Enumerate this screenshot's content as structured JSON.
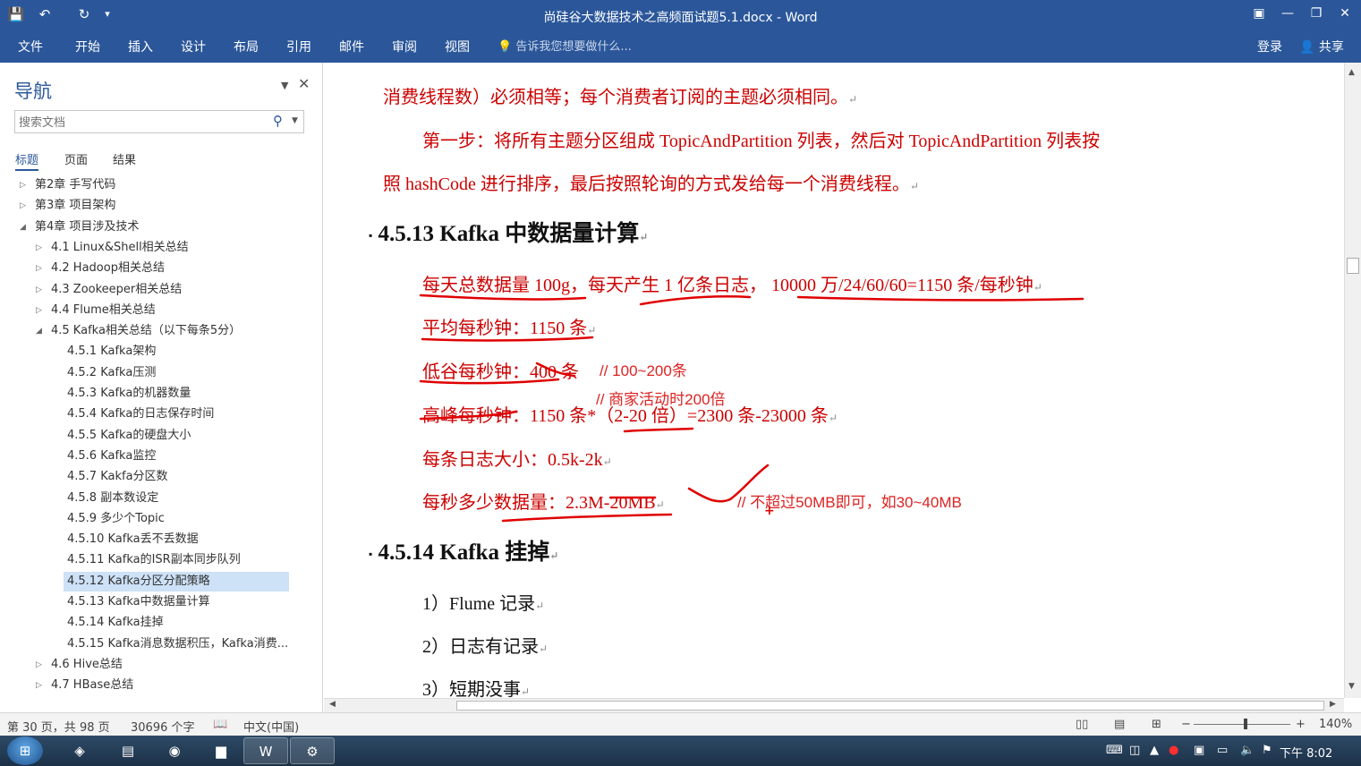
{
  "window": {
    "title": "尚硅谷大数据技术之高频面试题5.1.docx - Word",
    "qat": {
      "save": "💾",
      "undo": "↶",
      "redo": "↻",
      "customize": "▾"
    },
    "controls": {
      "ribbon_options": "▣",
      "minimize": "—",
      "restore": "❐",
      "close": "✕"
    }
  },
  "ribbon": {
    "tabs": [
      "文件",
      "开始",
      "插入",
      "设计",
      "布局",
      "引用",
      "邮件",
      "审阅",
      "视图"
    ],
    "tell_me": "告诉我您想要做什么...",
    "tell_me_icon": "💡",
    "sign_in": "登录",
    "share": "共享",
    "share_icon": "👤"
  },
  "nav": {
    "title": "导航",
    "search_placeholder": "搜索文档",
    "search_icon": "⚲",
    "tabs": [
      "标题",
      "页面",
      "结果"
    ],
    "items": [
      {
        "label": "第2章 手写代码",
        "level": 0,
        "expand": "▷"
      },
      {
        "label": "第3章 项目架构",
        "level": 0,
        "expand": "▷"
      },
      {
        "label": "第4章 项目涉及技术",
        "level": 0,
        "expand": "◢"
      },
      {
        "label": "4.1 Linux&Shell相关总结",
        "level": 1,
        "expand": "▷"
      },
      {
        "label": "4.2 Hadoop相关总结",
        "level": 1,
        "expand": "▷"
      },
      {
        "label": "4.3 Zookeeper相关总结",
        "level": 1,
        "expand": "▷"
      },
      {
        "label": "4.4 Flume相关总结",
        "level": 1,
        "expand": "▷"
      },
      {
        "label": "4.5 Kafka相关总结（以下每条5分）",
        "level": 1,
        "expand": "◢"
      },
      {
        "label": "4.5.1 Kafka架构",
        "level": 2,
        "expand": ""
      },
      {
        "label": "4.5.2 Kafka压测",
        "level": 2,
        "expand": ""
      },
      {
        "label": "4.5.3 Kafka的机器数量",
        "level": 2,
        "expand": ""
      },
      {
        "label": "4.5.4 Kafka的日志保存时间",
        "level": 2,
        "expand": ""
      },
      {
        "label": "4.5.5 Kafka的硬盘大小",
        "level": 2,
        "expand": ""
      },
      {
        "label": "4.5.6 Kafka监控",
        "level": 2,
        "expand": ""
      },
      {
        "label": "4.5.7 Kakfa分区数",
        "level": 2,
        "expand": ""
      },
      {
        "label": "4.5.8 副本数设定",
        "level": 2,
        "expand": ""
      },
      {
        "label": "4.5.9 多少个Topic",
        "level": 2,
        "expand": ""
      },
      {
        "label": "4.5.10 Kafka丢不丢数据",
        "level": 2,
        "expand": ""
      },
      {
        "label": "4.5.11 Kafka的ISR副本同步队列",
        "level": 2,
        "expand": ""
      },
      {
        "label": "4.5.12 Kafka分区分配策略",
        "level": 2,
        "expand": "",
        "selected": true
      },
      {
        "label": "4.5.13 Kafka中数据量计算",
        "level": 2,
        "expand": ""
      },
      {
        "label": "4.5.14 Kafka挂掉",
        "level": 2,
        "expand": ""
      },
      {
        "label": "4.5.15 Kafka消息数据积压，Kafka消费...",
        "level": 2,
        "expand": ""
      },
      {
        "label": "4.6 Hive总结",
        "level": 1,
        "expand": "▷"
      },
      {
        "label": "4.7 HBase总结",
        "level": 1,
        "expand": "▷"
      }
    ]
  },
  "document": {
    "para_mark": "↵",
    "line1": "消费线程数）必须相等；每个消费者订阅的主题必须相同。",
    "line2": "第一步：将所有主题分区组成 TopicAndPartition 列表，然后对 TopicAndPartition 列表按",
    "line3": "照 hashCode 进行排序，最后按照轮询的方式发给每一个消费线程。",
    "heading1": "4.5.13 Kafka 中数据量计算",
    "calc1": "每天总数据量 100g，每天产生 1 亿条日志，  10000 万/24/60/60=1150 条/每秒钟",
    "calc2": "平均每秒钟：1150 条",
    "calc3": "低谷每秒钟：400 条",
    "calc4": "高峰每秒钟：1150 条*（2-20 倍）=2300 条-23000 条",
    "calc5": "每条日志大小：0.5k-2k",
    "calc6": "每秒多少数据量：2.3M-20MB",
    "heading2": "4.5.14 Kafka 挂掉",
    "list1": "1）Flume 记录",
    "list2": "2）日志有记录",
    "list3": "3）短期没事",
    "notes": {
      "low": "// 100~200条",
      "peak": "// 商家活动时200倍",
      "rate": "// 不超过50MB即可，如30~40MB"
    },
    "ink_color": "#e00000"
  },
  "status": {
    "page": "第 30 页，共 98 页",
    "words": "30696 个字",
    "proof_icon": "📖",
    "language": "中文(中国)",
    "view_read": "▯▯",
    "view_print": "▤",
    "view_web": "⊞",
    "zoom_out": "−",
    "zoom_in": "+",
    "zoom": "140%"
  },
  "taskbar": {
    "start": "⊞",
    "apps": [
      {
        "name": "app-icon-1",
        "glyph": "◈",
        "open": false
      },
      {
        "name": "notepad-icon",
        "glyph": "▤",
        "open": false
      },
      {
        "name": "chrome-icon",
        "glyph": "◉",
        "open": false
      },
      {
        "name": "explorer-icon",
        "glyph": "▆",
        "open": false
      },
      {
        "name": "word-icon",
        "glyph": "W",
        "open": true
      },
      {
        "name": "app-icon-6",
        "glyph": "⚙",
        "open": true
      }
    ],
    "clock": "下午 8:02"
  }
}
